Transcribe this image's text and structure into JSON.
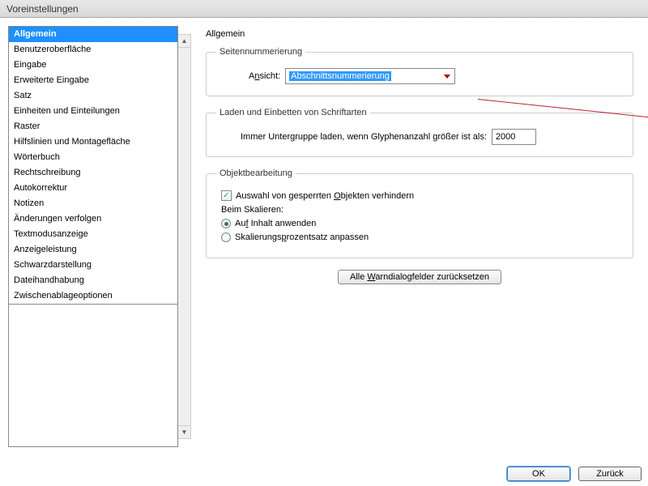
{
  "window": {
    "title": "Voreinstellungen"
  },
  "sidebar": {
    "items": [
      {
        "label": "Allgemein",
        "selected": true
      },
      {
        "label": "Benutzeroberfläche"
      },
      {
        "label": "Eingabe"
      },
      {
        "label": "Erweiterte Eingabe"
      },
      {
        "label": "Satz"
      },
      {
        "label": "Einheiten und Einteilungen"
      },
      {
        "label": "Raster"
      },
      {
        "label": "Hilfslinien und Montagefläche"
      },
      {
        "label": "Wörterbuch"
      },
      {
        "label": "Rechtschreibung"
      },
      {
        "label": "Autokorrektur"
      },
      {
        "label": "Notizen"
      },
      {
        "label": "Änderungen verfolgen"
      },
      {
        "label": "Textmodusanzeige"
      },
      {
        "label": "Anzeigeleistung"
      },
      {
        "label": "Schwarzdarstellung"
      },
      {
        "label": "Dateihandhabung"
      },
      {
        "label": "Zwischenablageoptionen"
      }
    ]
  },
  "panel": {
    "title": "Allgemein",
    "page_numbering": {
      "legend": "Seitennummerierung",
      "view_label_pre": "A",
      "view_label_u": "n",
      "view_label_post": "sicht:",
      "selected": "Abschnittsnummerierung"
    },
    "fonts": {
      "legend": "Laden und Einbetten von Schriftarten",
      "label_pre": "Immer Unter",
      "label_u": "g",
      "label_post": "ruppe laden, wenn Glyphenanzahl größer ist als:",
      "value": "2000"
    },
    "object": {
      "legend": "Objektbearbeitung",
      "lock_pre": "Auswahl von gesperrten ",
      "lock_u": "O",
      "lock_post": "bjekten verhindern",
      "lock_checked": true,
      "scaling_heading": "Beim Skalieren:",
      "opt1_pre": "Au",
      "opt1_u": "f",
      "opt1_post": " Inhalt anwenden",
      "opt2_pre": "Skalierungs",
      "opt2_u": "p",
      "opt2_post": "rozentsatz anpassen",
      "selected_opt": 1
    },
    "reset_pre": "Alle ",
    "reset_u": "W",
    "reset_post": "arndialogfelder zurücksetzen"
  },
  "footer": {
    "ok": "OK",
    "back": "Zurück"
  }
}
